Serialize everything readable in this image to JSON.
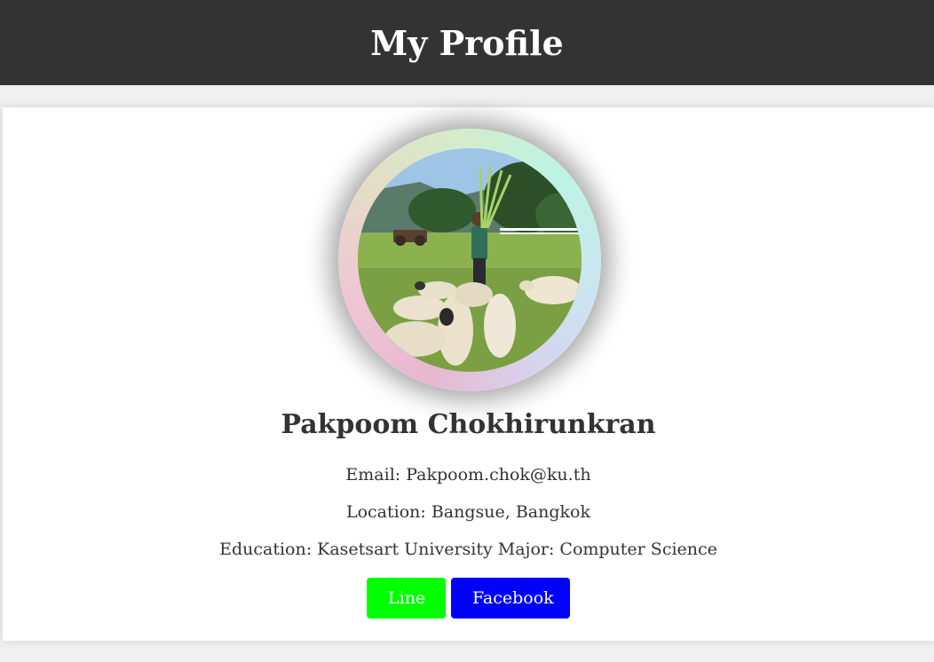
{
  "header": {
    "title": "My Profile"
  },
  "profile": {
    "name": "Pakpoom Chokhirunkran",
    "email": "Email: Pakpoom.chok@ku.th",
    "location": "Location: Bangsue, Bangkok",
    "education": "Education: Kasetsart University Major: Computer Science"
  },
  "buttons": {
    "line_label": "Line",
    "facebook_label": "Facebook"
  },
  "colors": {
    "header_bg": "#333333",
    "line_button": "#00ff00",
    "facebook_button": "#0000ff"
  }
}
